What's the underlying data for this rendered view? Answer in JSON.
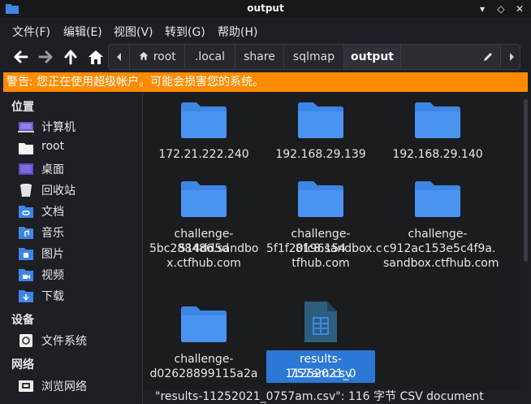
{
  "window": {
    "title": "output",
    "minimize": "▾",
    "restore": "◇",
    "close": "✕"
  },
  "menu": [
    "文件(F)",
    "编辑(E)",
    "视图(V)",
    "转到(G)",
    "帮助(H)"
  ],
  "path": {
    "crumbs": [
      "root",
      ".local",
      "share",
      "sqlmap",
      "output"
    ]
  },
  "warning": "警告: 您正在使用超级帐户。可能会损害您的系统。",
  "sidebar": {
    "places_title": "位置",
    "places": [
      "计算机",
      "root",
      "桌面",
      "回收站",
      "文档",
      "音乐",
      "图片",
      "视频",
      "下载"
    ],
    "devices_title": "设备",
    "devices": [
      "文件系统"
    ],
    "network_title": "网络",
    "network": [
      "浏览网络"
    ]
  },
  "files": [
    {
      "name": [
        "172.21.222.240"
      ],
      "type": "folder"
    },
    {
      "name": [
        "192.168.29.139"
      ],
      "type": "folder"
    },
    {
      "name": [
        "192.168.29.140"
      ],
      "type": "folder"
    },
    {
      "name": [
        "challenge-514dd5d",
        "5bc288486.sandbo",
        "x.ctfhub.com"
      ],
      "type": "folder"
    },
    {
      "name": [
        "challenge-8196154",
        "5f1f20fc8.sandbox.c",
        "tfhub.com"
      ],
      "type": "folder"
    },
    {
      "name": [
        "challenge-",
        "c912ac153e5c4f9a.",
        "sandbox.ctfhub.com"
      ],
      "type": "folder"
    },
    {
      "name": [
        "challenge-",
        "d02628899115a2a"
      ],
      "type": "folder"
    },
    {
      "name": [
        "results-11252021_0",
        "757am.csv"
      ],
      "type": "csv",
      "selected": true
    }
  ],
  "status": "\"results-11252021_0757am.csv\": 116 字节 CSV document",
  "colors": {
    "accent": "#2b78d6",
    "folder": "#3d86e6",
    "warning": "#ff8c00"
  }
}
